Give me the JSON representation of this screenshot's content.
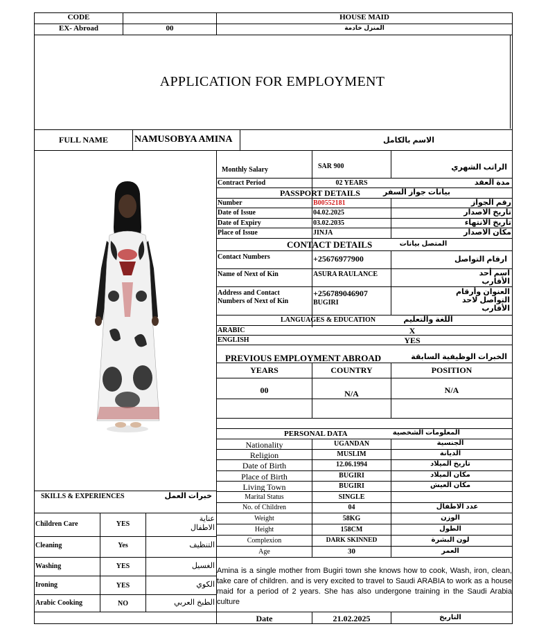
{
  "header": {
    "code_label": "CODE",
    "code_value": "",
    "ex_abroad_label": "EX- Abroad",
    "ex_abroad_value": "00",
    "position_en": "HOUSE MAID",
    "position_ar": "المنزل خادمة"
  },
  "title": "APPLICATION FOR EMPLOYMENT",
  "full_name": {
    "label": "FULL NAME",
    "value": "NAMUSOBYA AMINA",
    "label_ar": "الاسم بالكامل"
  },
  "contract": {
    "salary_label": "Monthly Salary",
    "salary_value": "SAR 900",
    "salary_ar": "الراتب الشهري",
    "period_label": "Contract Period",
    "period_value": "02 YEARS",
    "period_ar": "مدة العقد"
  },
  "passport": {
    "heading": "PASSPORT DETAILS",
    "heading_ar": "بيانات جواز السفر",
    "number_label": "Number",
    "number_value": "B00552181",
    "number_ar": "رقم الجواز",
    "issue_label": "Date of Issue",
    "issue_value": "04.02.2025",
    "issue_ar": "تاريخ الاصدار",
    "expiry_label": "Date of Expiry",
    "expiry_value": "03.02.2035",
    "expiry_ar": "تاريخ الانتهاء",
    "place_label": "Place of Issue",
    "place_value": "JINJA",
    "place_ar": "مكان الاصدار"
  },
  "contact": {
    "heading": "CONTACT DETAILS",
    "heading_ar": "المتصل بيانات",
    "numbers_label": "Contact Numbers",
    "numbers_value": "+25676977900",
    "numbers_ar": "ارقام التواصل",
    "kin_label": "Name of Next of Kin",
    "kin_value": "ASURA RAULANCE",
    "kin_ar_1": "اسم أحد",
    "kin_ar_2": "الأقارب",
    "address_label_1": "Address and Contact",
    "address_label_2": "Numbers of Next of Kin",
    "address_phone": "+256789046907",
    "address_town": "BUGIRI",
    "address_ar_1": "العنوان وأرقام",
    "address_ar_2": "التواصل لاحد",
    "address_ar_3": "الأقارب"
  },
  "languages": {
    "heading": "LANGUAGES & EDUCATION",
    "heading_ar": "اللغة والتعليم",
    "rows": [
      {
        "label": "ARABIC",
        "mark1": "X",
        "mark2": ""
      },
      {
        "label": "ENGLISH",
        "mark1": "",
        "mark2": "YES"
      }
    ]
  },
  "previous": {
    "heading": "PREVIOUS EMPLOYMENT ABROAD",
    "heading_ar": "الخبرات الوظيفية السابقة",
    "col_years": "YEARS",
    "col_country": "COUNTRY",
    "col_position": "POSITION",
    "years": "00",
    "country": "N/A",
    "position": "N/A"
  },
  "personal": {
    "heading": "PERSONAL DATA",
    "heading_ar": "المعلومات الشخصية",
    "rows": [
      {
        "label": "Nationality",
        "value": "UGANDAN",
        "ar": "الجنسية"
      },
      {
        "label": "Religion",
        "value": "MUSLIM",
        "ar": "الديانة"
      },
      {
        "label": "Date of Birth",
        "value": "12.06.1994",
        "ar": "تاريخ الميلاد"
      },
      {
        "label": "Place of Birth",
        "value": "BUGIRI",
        "ar": "مكان الميلاد"
      },
      {
        "label": "Living Town",
        "value": "BUGIRI",
        "ar": "مكان العيش"
      },
      {
        "label": "Marital Status",
        "value": "SINGLE",
        "ar": ""
      },
      {
        "label": "No. of Children",
        "value": "04",
        "ar": "عدد الاطفال"
      },
      {
        "label": "Weight",
        "value": "58KG",
        "ar": "الوزن"
      },
      {
        "label": "Height",
        "value": "158CM",
        "ar": "الطول"
      },
      {
        "label": "Complexion",
        "value": "DARK SKINNED",
        "ar": "لون البشرة"
      },
      {
        "label": "Age",
        "value": "30",
        "ar": "العمر"
      }
    ]
  },
  "skills": {
    "heading": "SKILLS & EXPERIENCES",
    "heading_ar": "خبرات العمل",
    "rows": [
      {
        "label": "Children Care",
        "value": "YES",
        "ar_1": "عناية",
        "ar_2": "الاطفال"
      },
      {
        "label": "Cleaning",
        "value": "Yes",
        "ar_1": "التنظيف",
        "ar_2": ""
      },
      {
        "label": "Washing",
        "value": "YES",
        "ar_1": "الغسيل",
        "ar_2": ""
      },
      {
        "label": "Ironing",
        "value": "YES",
        "ar_1": "الكوي",
        "ar_2": ""
      },
      {
        "label": "Arabic Cooking",
        "value": "NO",
        "ar_1": "الطبخ العربي",
        "ar_2": ""
      }
    ]
  },
  "description": "Amina is a single mother from Bugiri town she knows how to cook, Wash, iron, clean, take care of children. and is very excited to travel to Saudi ARABIA to work as a house maid for a period of 2 years. She has also undergone training in the Saudi Arabia culture",
  "date": {
    "label": "Date",
    "value": "21.02.2025",
    "ar": "التاريخ"
  }
}
